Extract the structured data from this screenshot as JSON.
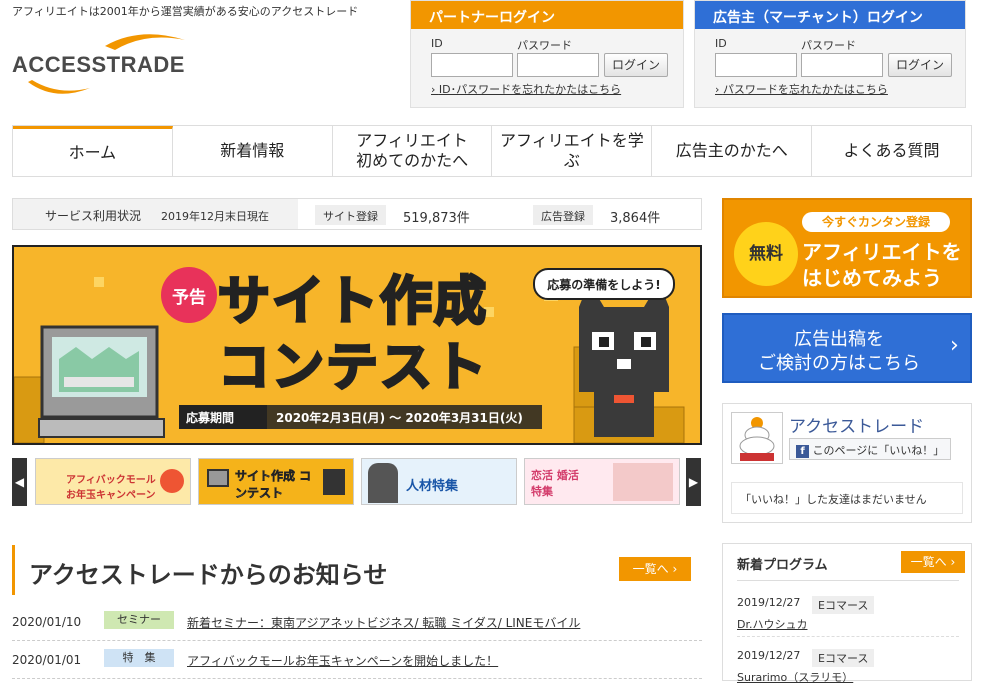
{
  "header": {
    "tagline": "アフィリエイトは2001年から運営実績がある安心のアクセストレード",
    "logo_text": "ACCESSTRADE"
  },
  "partner_login": {
    "title": "パートナーログイン",
    "id_label": "ID",
    "password_label": "パスワード",
    "button": "ログイン",
    "forgot": "ID･パスワードを忘れたかたはこちら"
  },
  "merchant_login": {
    "title": "広告主（マーチャント）ログイン",
    "id_label": "ID",
    "password_label": "パスワード",
    "button": "ログイン",
    "forgot": "パスワードを忘れたかたはこちら"
  },
  "nav": {
    "items": [
      "ホーム",
      "新着情報",
      "アフィリエイト\n初めてのかたへ",
      "アフィリエイトを学ぶ",
      "広告主のかたへ",
      "よくある質問"
    ]
  },
  "service": {
    "title": "サービス利用状況",
    "date": "2019年12月末日現在",
    "site_label": "サイト登録",
    "site_count": "519,873件",
    "ad_label": "広告登録",
    "ad_count": "3,864件"
  },
  "banner": {
    "badge": "予告",
    "title_line1": "サイト作成",
    "title_line2": "コンテスト",
    "bubble": "応募の準備をしよう!",
    "period_label": "応募期間",
    "period": "2020年2月3日(月) 〜 2020年3月31日(火)"
  },
  "thumbnails": [
    {
      "text": "アフィバックモール お年玉キャンペーン",
      "color": "#fde9a8"
    },
    {
      "text": "サイト作成 コンテスト",
      "color": "#f5b31a"
    },
    {
      "text": "人材特集",
      "color": "#e6f2fb"
    },
    {
      "text": "恋活 婚活 特集",
      "color": "#ffe9ef"
    }
  ],
  "news": {
    "title": "アクセストレードからのお知らせ",
    "more": "一覧へ",
    "items": [
      {
        "date": "2020/01/10",
        "category": "セミナー",
        "cat_color": "#cfe8b2",
        "text": "新着セミナー：東南アジアネットビジネス/ 転職 ミイダス/ LINEモバイル"
      },
      {
        "date": "2020/01/01",
        "category": "特　集",
        "cat_color": "#cfe3f5",
        "text": "アフィバックモールお年玉キャンペーンを開始しました！"
      }
    ]
  },
  "cta_affiliate": {
    "free": "無料",
    "pill": "今すぐカンタン登録",
    "line1": "アフィリエイトを",
    "line2": "はじめてみよう"
  },
  "cta_advertiser": {
    "line1": "広告出稿を",
    "line2": "ご検討の方はこちら"
  },
  "facebook": {
    "page_name": "アクセストレード",
    "like_button": "このページに「いいね！」",
    "note": "「いいね！」した友達はまだいません"
  },
  "programs": {
    "title": "新着プログラム",
    "more": "一覧へ",
    "items": [
      {
        "date": "2019/12/27",
        "category": "Eコマース",
        "name": "Dr.ハウシュカ"
      },
      {
        "date": "2019/12/27",
        "category": "Eコマース",
        "name": "Surarimo（スラリモ）"
      }
    ]
  }
}
